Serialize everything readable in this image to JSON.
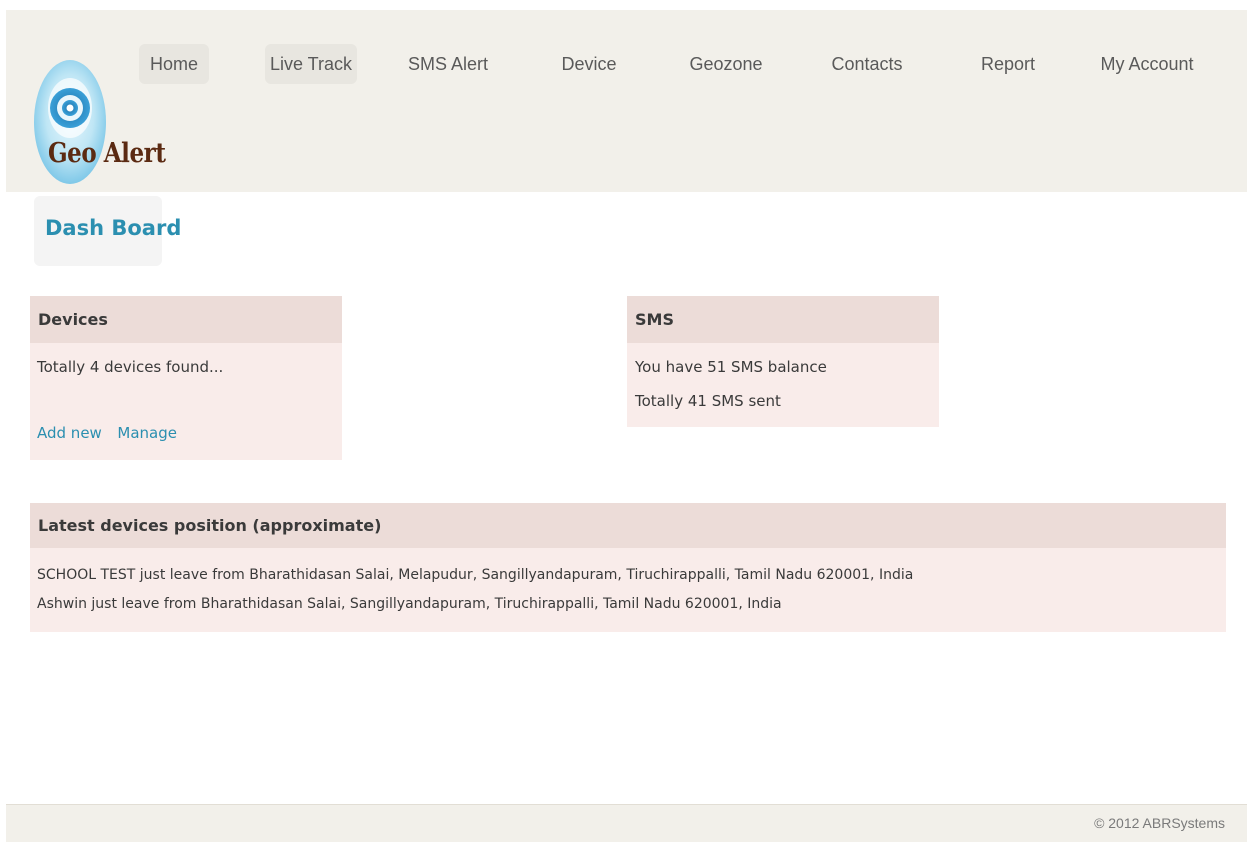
{
  "logo": {
    "text": "Geo Alert"
  },
  "nav": [
    {
      "label": "Home"
    },
    {
      "label": "Live Track"
    },
    {
      "label": "SMS Alert"
    },
    {
      "label": "Device"
    },
    {
      "label": "Geozone"
    },
    {
      "label": "Contacts"
    },
    {
      "label": "Report"
    },
    {
      "label": "My Account"
    }
  ],
  "page_title": "Dash Board",
  "devices_panel": {
    "title": "Devices",
    "summary": "Totally 4 devices found...",
    "add_label": "Add new",
    "manage_label": "Manage"
  },
  "sms_panel": {
    "title": "SMS",
    "balance_text": "You have 51 SMS balance",
    "sent_text": "Totally 41 SMS sent"
  },
  "positions_panel": {
    "title": "Latest devices position (approximate)",
    "entries": [
      "SCHOOL TEST just leave from Bharathidasan Salai, Melapudur, Sangillyandapuram, Tiruchirappalli, Tamil Nadu 620001, India",
      "Ashwin just leave from Bharathidasan Salai, Sangillyandapuram, Tiruchirappalli, Tamil Nadu 620001, India"
    ]
  },
  "footer": {
    "copyright": "© 2012 ABRSystems"
  },
  "colors": {
    "accent": "#2b8fb0",
    "panel_header": "#ecdcd8",
    "panel_body": "#f9ecea",
    "header_bg": "#f2f0ea"
  }
}
